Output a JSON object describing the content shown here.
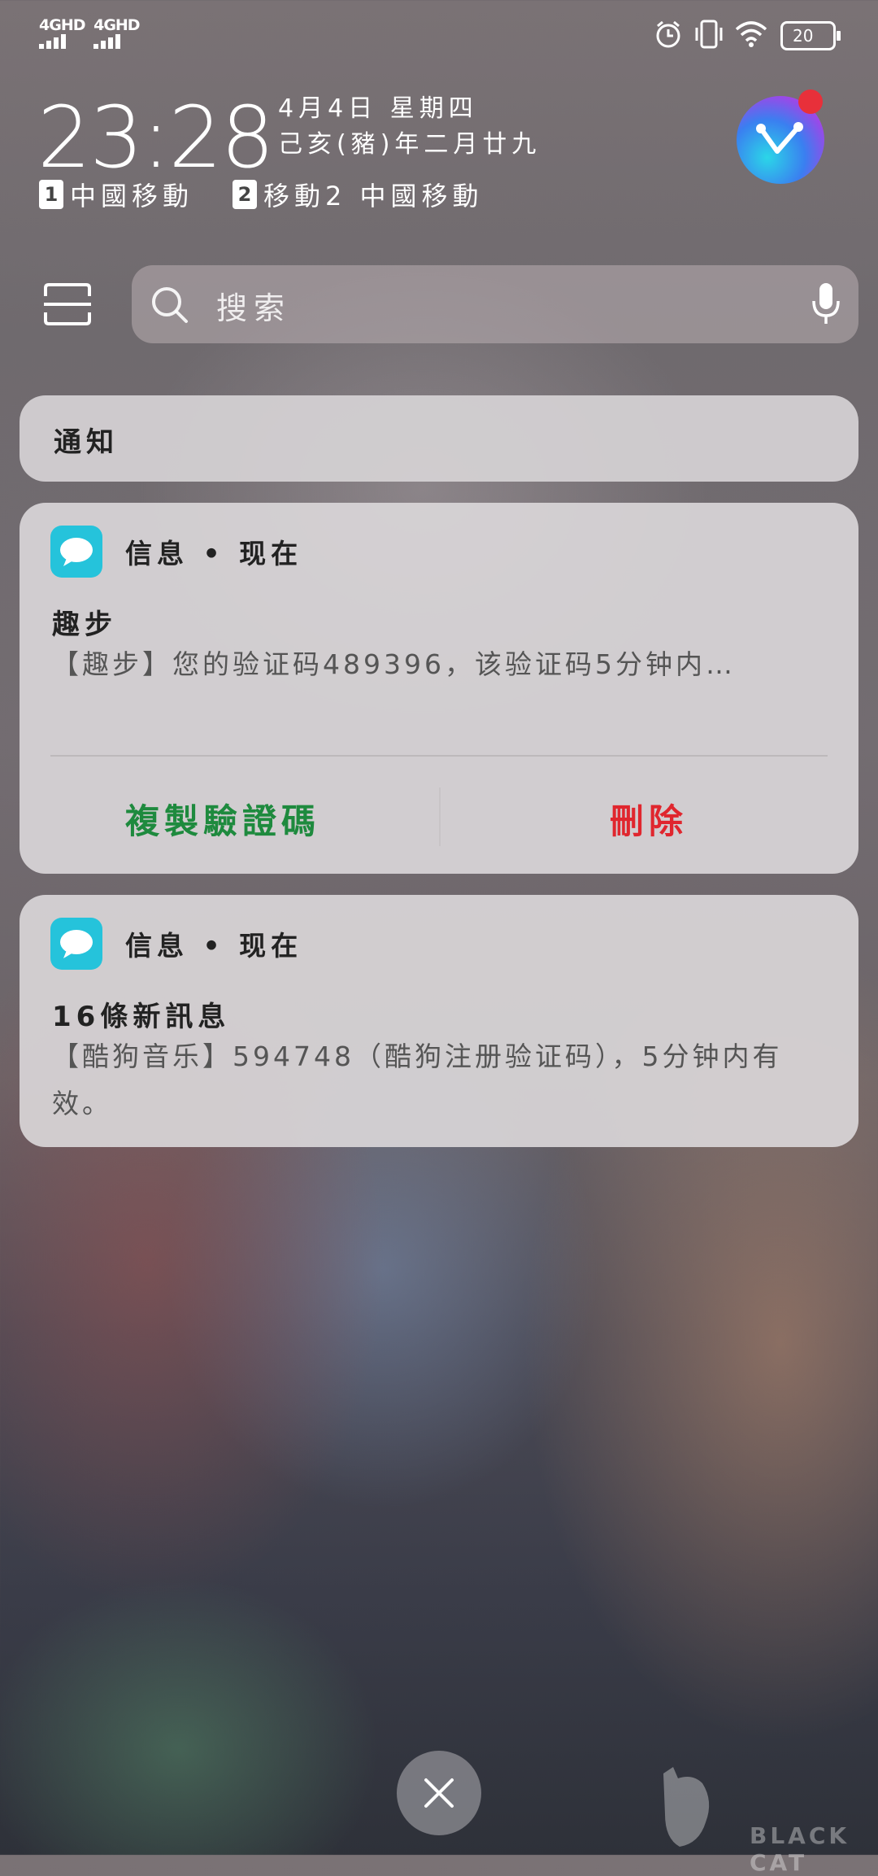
{
  "status_bar": {
    "sim1_label": "4GHD",
    "sim2_label": "4GHD",
    "battery": "20",
    "icons": [
      "alarm-icon",
      "vibrate-icon",
      "wifi-icon",
      "battery-icon"
    ]
  },
  "lockscreen": {
    "time": "23:28",
    "date_line": "4月4日 星期四",
    "lunar_line": "己亥(豬)年二月廿九",
    "sim1_num": "1",
    "sim1_name": "中國移動",
    "sim2_num": "2",
    "sim2_name": "移動2 中國移動"
  },
  "search": {
    "placeholder": "搜索"
  },
  "notifications_header": "通知",
  "cards": [
    {
      "app": "信息 • 现在",
      "title": "趣步",
      "body": "【趣步】您的验证码489396，该验证码5分钟内…",
      "action_copy": "複製驗證碼",
      "action_delete": "刪除"
    },
    {
      "app": "信息 • 现在",
      "title": "16條新訊息",
      "body": "【酷狗音乐】594748（酷狗注册验证码），5分钟内有效。"
    }
  ],
  "colors": {
    "copy_action": "#1e8a3e",
    "delete_action": "#e0262e",
    "app_icon": "#25c3db",
    "badge": "#e8303a"
  },
  "watermark_text": "BLACK CAT"
}
